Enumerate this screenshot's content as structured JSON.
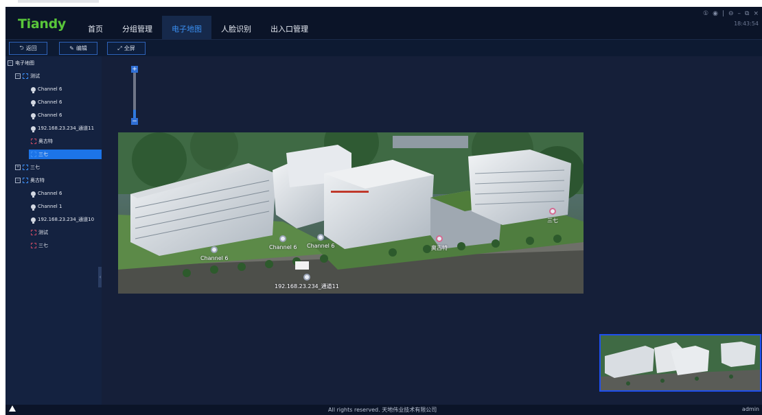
{
  "app": {
    "logo": "Tiandy",
    "nav": [
      {
        "label": "首页",
        "active": false
      },
      {
        "label": "分组管理",
        "active": false
      },
      {
        "label": "电子地图",
        "active": true
      },
      {
        "label": "人脸识别",
        "active": false
      },
      {
        "label": "出入口管理",
        "active": false
      }
    ],
    "window_controls": [
      "①",
      "◉",
      "|",
      "⊖",
      "–",
      "⧉",
      "×"
    ],
    "clock": "18:43:54"
  },
  "toolbar": {
    "back_label": "返回",
    "edit_label": "编辑",
    "fullscreen_label": "全屏"
  },
  "tree": {
    "root": "电子地图",
    "items": [
      {
        "label": "测试",
        "kind": "map",
        "expanded": true
      },
      {
        "label": "Channel 6",
        "kind": "camera"
      },
      {
        "label": "Channel 6",
        "kind": "camera"
      },
      {
        "label": "Channel 6",
        "kind": "camera"
      },
      {
        "label": "192.168.23.234_通道11",
        "kind": "camera"
      },
      {
        "label": "奥古特",
        "kind": "map-link"
      },
      {
        "label": "三七",
        "kind": "map-link",
        "selected": true
      },
      {
        "label": "三七",
        "kind": "map",
        "expanded": false
      },
      {
        "label": "奥古特",
        "kind": "map",
        "expanded": true
      },
      {
        "label": "Channel 6",
        "kind": "camera"
      },
      {
        "label": "Channel 1",
        "kind": "camera"
      },
      {
        "label": "192.168.23.234_通道10",
        "kind": "camera"
      },
      {
        "label": "测试",
        "kind": "map-link"
      },
      {
        "label": "三七",
        "kind": "map-link"
      }
    ]
  },
  "map": {
    "zoom_in": "+",
    "zoom_out": "−",
    "markers": [
      {
        "label": "Channel 6",
        "type": "camera"
      },
      {
        "label": "Channel 6",
        "type": "camera"
      },
      {
        "label": "Channel 6",
        "type": "camera"
      },
      {
        "label": "192.168.23.234_通道11",
        "type": "camera"
      },
      {
        "label": "奥古特",
        "type": "map-link"
      },
      {
        "label": "三七",
        "type": "map-link"
      }
    ]
  },
  "status": {
    "copyright": "All rights reserved. 天地伟业技术有限公司",
    "user": "admin"
  },
  "colors": {
    "accent": "#1c74e8",
    "logo": "#59c63a",
    "background": "#111c33"
  }
}
